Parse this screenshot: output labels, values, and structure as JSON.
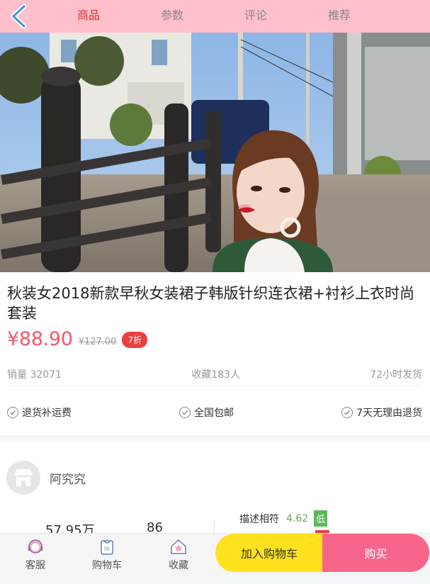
{
  "nav": {
    "tabs": [
      {
        "label": "商品",
        "active": true
      },
      {
        "label": "参数",
        "active": false
      },
      {
        "label": "评论",
        "active": false
      },
      {
        "label": "推荐",
        "active": false
      }
    ],
    "back_icon": "chevron-left-icon",
    "accent": "#e02e24",
    "bg_color": "#ffc0cb"
  },
  "product": {
    "title": "秋装女2018新款早秋女装裙子韩版针织连衣裙+衬衫上衣时尚套装",
    "price": "¥88.90",
    "old_price": "¥127.00",
    "discount": "7折",
    "sales": "销量 32071",
    "favorites": "收藏183人",
    "shipping": "72小时发货",
    "guarantees": [
      "退货补运费",
      "全国包邮",
      "7天无理由退货"
    ]
  },
  "shop": {
    "name": "阿究究",
    "stat1": "57.95万",
    "stat2": "86",
    "rating_label": "描述相符",
    "rating_score": "4.62",
    "rating_tag": "低"
  },
  "bottom": {
    "service": "客服",
    "cart": "购物车",
    "favorite": "收藏",
    "add_to_cart": "加入购物车",
    "buy": "购买"
  }
}
